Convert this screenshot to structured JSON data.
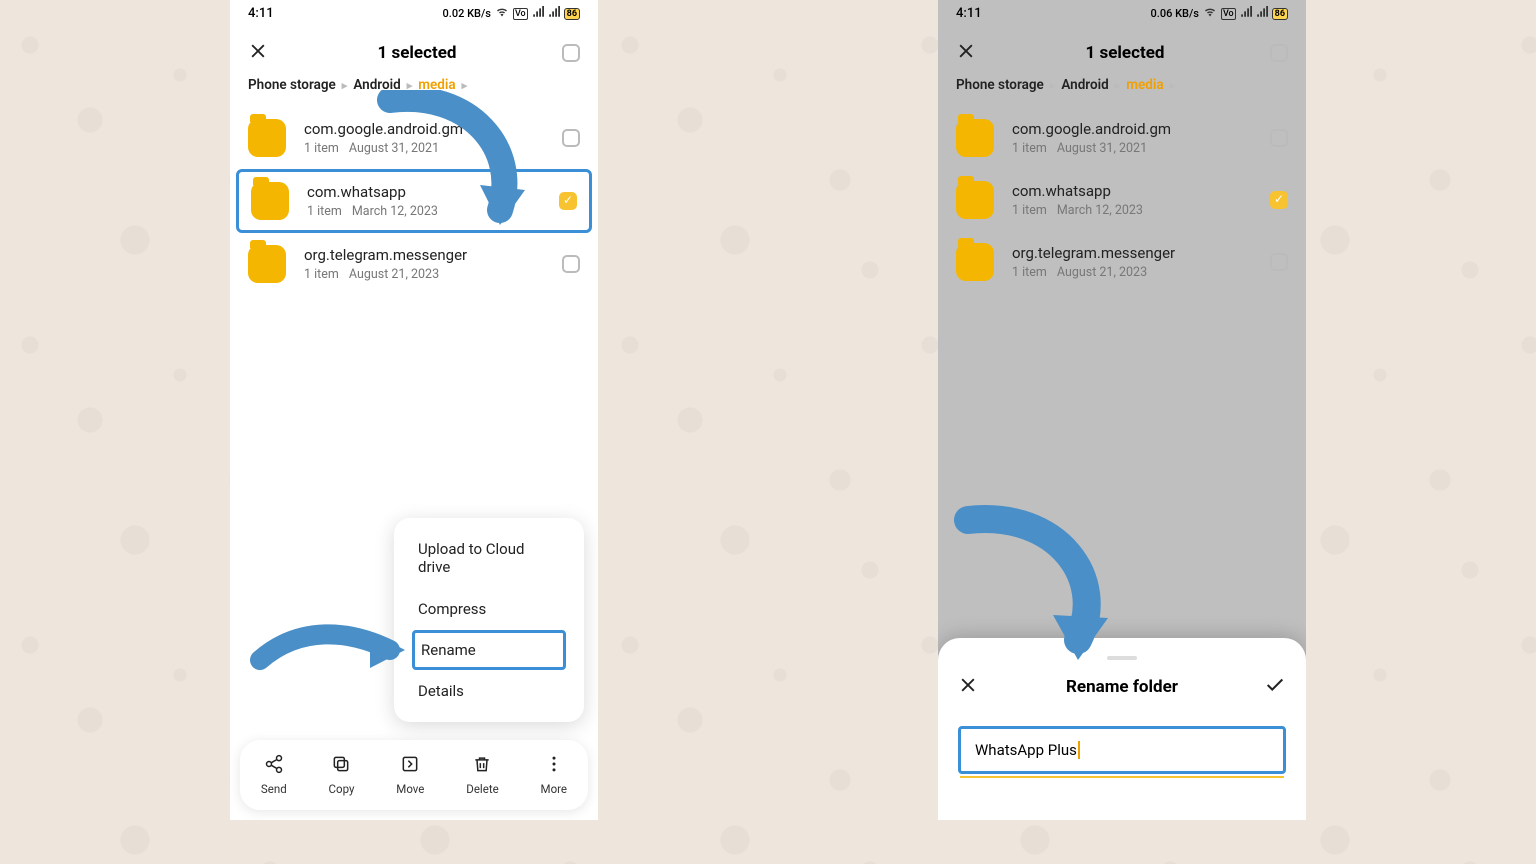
{
  "left": {
    "time": "4:11",
    "net_speed": "0.02 KB/s",
    "battery": "86",
    "header_title": "1 selected",
    "breadcrumb": [
      "Phone storage",
      "Android",
      "media"
    ],
    "rows": [
      {
        "name": "com.google.android.gm",
        "items": "1 item",
        "date": "August 31, 2021",
        "checked": false
      },
      {
        "name": "com.whatsapp",
        "items": "1 item",
        "date": "March 12, 2023",
        "checked": true
      },
      {
        "name": "org.telegram.messenger",
        "items": "1 item",
        "date": "August 21, 2023",
        "checked": false
      }
    ],
    "menu": [
      "Upload to Cloud drive",
      "Compress",
      "Rename",
      "Details"
    ],
    "bottom": {
      "send": "Send",
      "copy": "Copy",
      "move": "Move",
      "delete": "Delete",
      "more": "More"
    }
  },
  "right": {
    "time": "4:11",
    "net_speed": "0.06 KB/s",
    "battery": "86",
    "header_title": "1 selected",
    "breadcrumb": [
      "Phone storage",
      "Android",
      "media"
    ],
    "rows": [
      {
        "name": "com.google.android.gm",
        "items": "1 item",
        "date": "August 31, 2021",
        "checked": false
      },
      {
        "name": "com.whatsapp",
        "items": "1 item",
        "date": "March 12, 2023",
        "checked": true
      },
      {
        "name": "org.telegram.messenger",
        "items": "1 item",
        "date": "August 21, 2023",
        "checked": false
      }
    ],
    "sheet_title": "Rename folder",
    "rename_value": "WhatsApp Plus"
  }
}
